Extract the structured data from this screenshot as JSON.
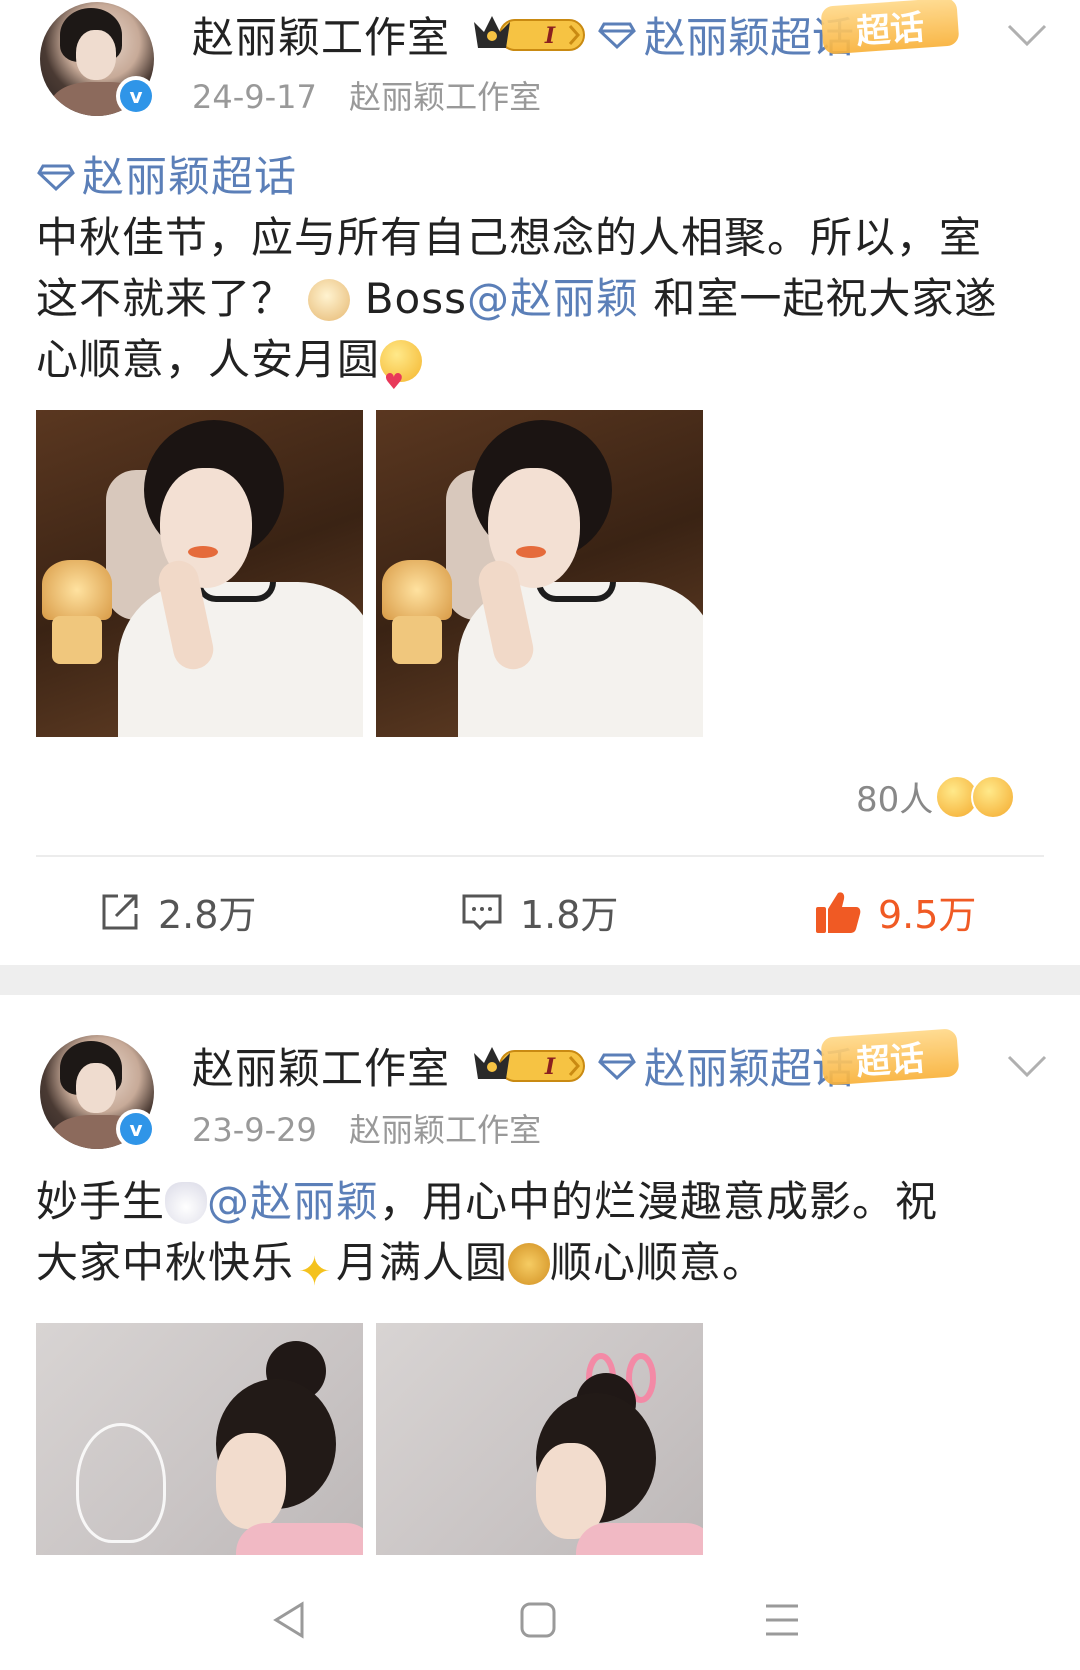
{
  "posts": [
    {
      "author": "赵丽颖工作室",
      "crown_badge": "I",
      "topic": "赵丽颖超话",
      "topic_sticker": "超话",
      "date": "24-9-17",
      "source": "赵丽颖工作室",
      "content": {
        "topic_tag": "赵丽颖超话",
        "line1": "中秋佳节，应与所有自己想念的人相聚。所以，室",
        "line2_pre": "这不就来了？",
        "line2_emoji": "doge-emoji",
        "line2_mid": "Boss",
        "line2_mention": "@赵丽颖",
        "line2_post": " 和室一起祝大家遂",
        "line3": "心顺意，人安月圆",
        "line3_emoji": "love-emoji"
      },
      "reactions_count": "80人",
      "stats": {
        "repost": "2.8万",
        "comment": "1.8万",
        "like": "9.5万"
      },
      "like_color": "#f05a24"
    },
    {
      "author": "赵丽颖工作室",
      "crown_badge": "I",
      "topic": "赵丽颖超话",
      "topic_sticker": "超话",
      "date": "23-9-29",
      "source": "赵丽颖工作室",
      "content": {
        "line1_pre": "妙手生",
        "line1_emoji": "rabbit-emoji",
        "line1_mention": "@赵丽颖",
        "line1_post": "，用心中的烂漫趣意成影。祝",
        "line2_pre": "大家中秋快乐",
        "line2_emoji": "sparkle-emoji",
        "line2_mid": "月满人圆",
        "line2_emoji2": "mooncake-emoji",
        "line2_post": "顺心顺意。"
      }
    }
  ],
  "colors": {
    "link": "#5b7fb8",
    "verified": "#2f95e8",
    "liked": "#f05a24",
    "separator": "#eeeeee"
  }
}
